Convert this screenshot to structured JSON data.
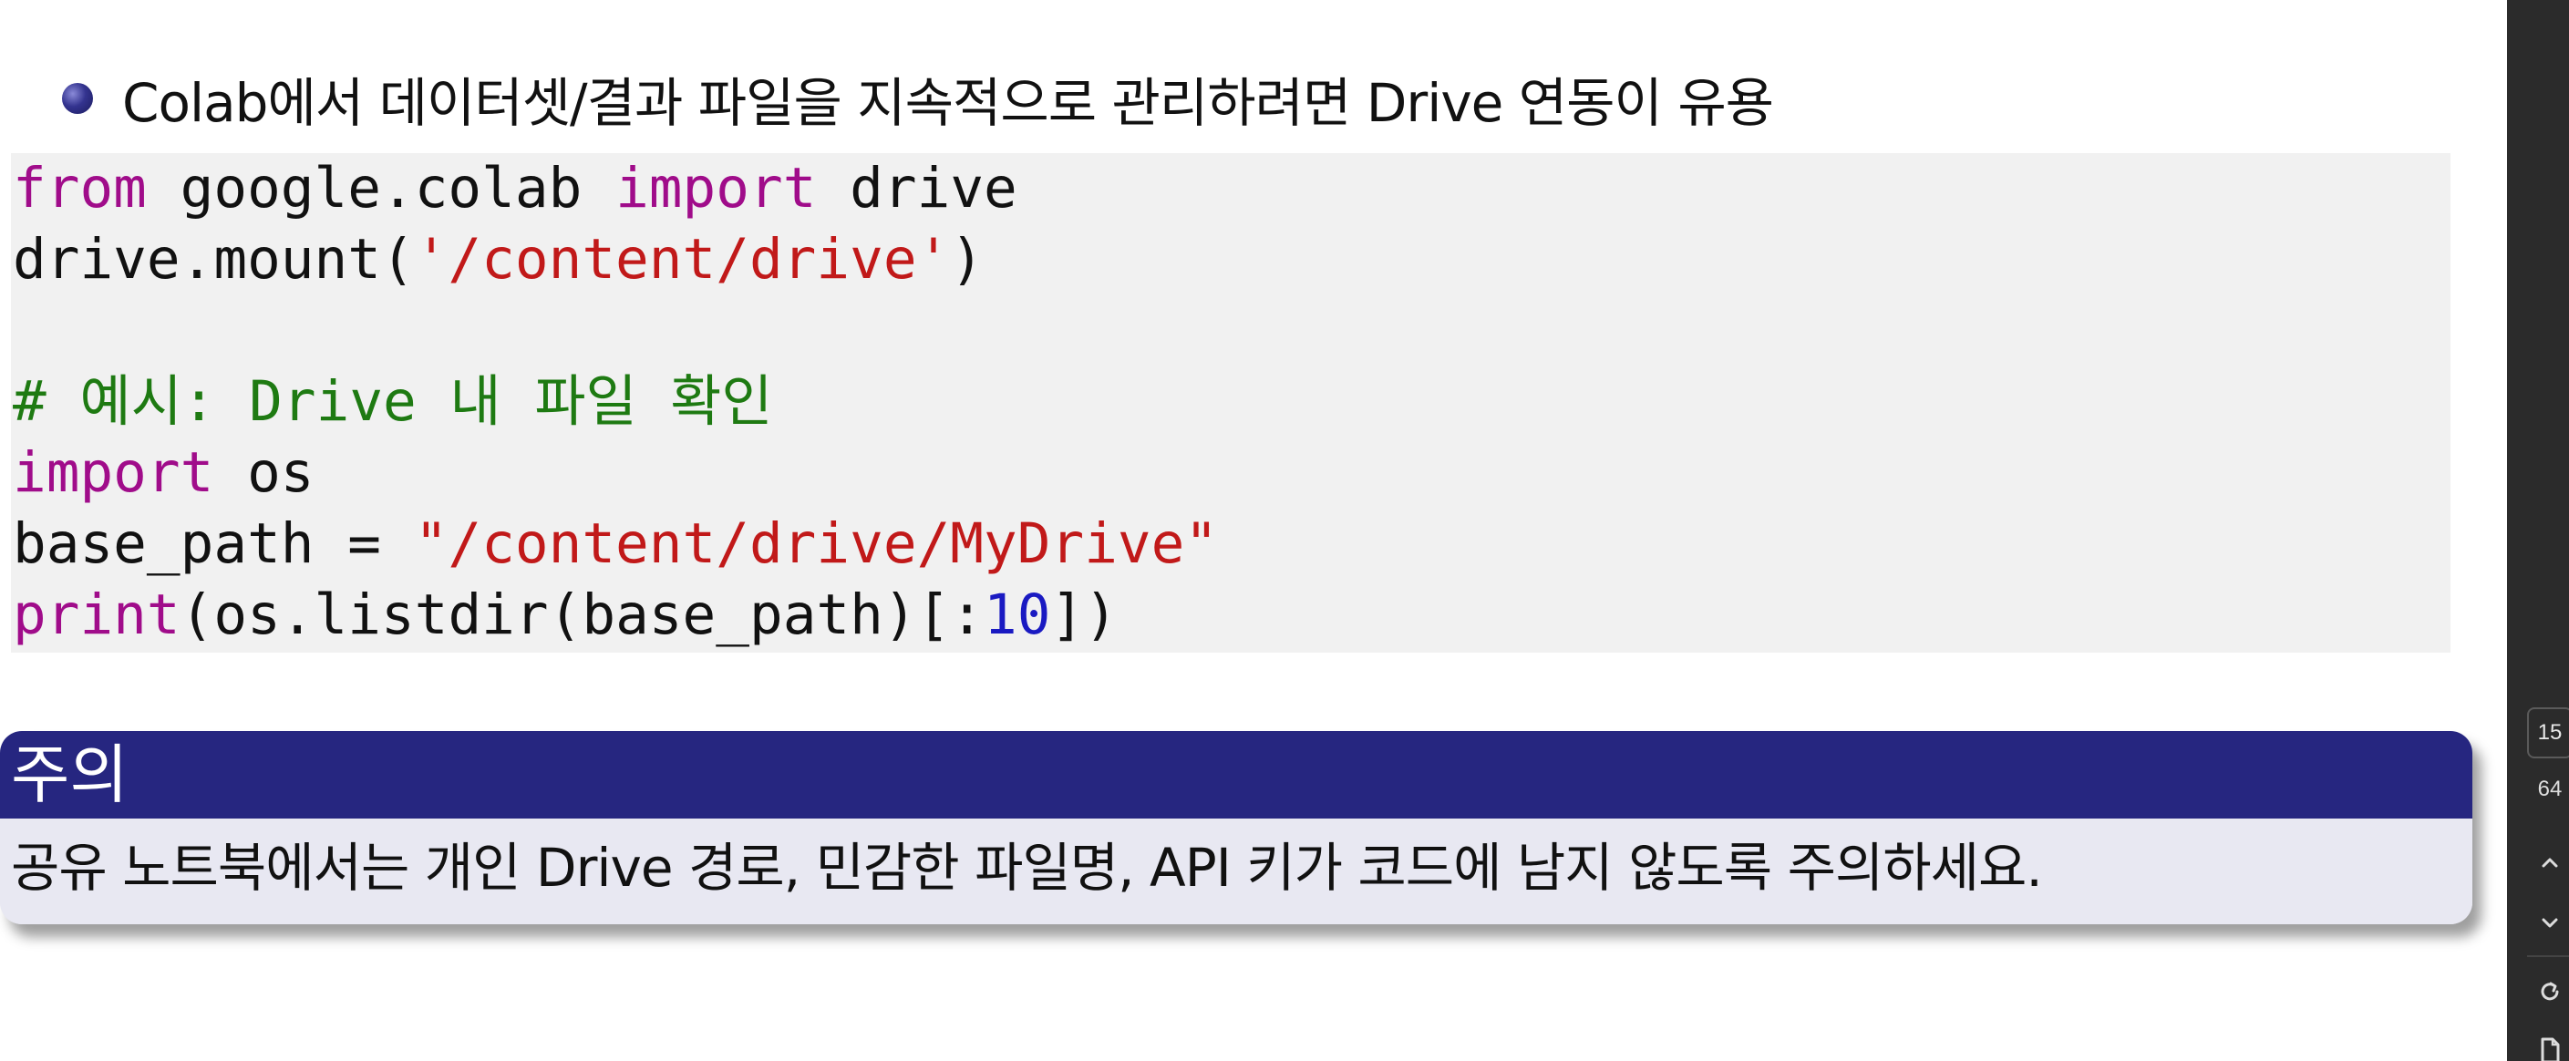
{
  "slide": {
    "bullet_text": "Colab에서 데이터셋/결과 파일을 지속적으로 관리하려면 Drive 연동이 유용",
    "code": {
      "line1": {
        "kw1": "from",
        "t1": " google.colab ",
        "kw2": "import",
        "t2": " drive"
      },
      "line2": {
        "t1": "drive.mount(",
        "s1": "'/content/drive'",
        "t2": ")"
      },
      "line4": {
        "comment": "# 예시: Drive 내 파일 확인"
      },
      "line5": {
        "kw1": "import",
        "t1": " os"
      },
      "line6": {
        "t1": "base_path = ",
        "s1": "\"/content/drive/MyDrive\""
      },
      "line7": {
        "kw1": "print",
        "t1": "(os.listdir(base_path)[:",
        "n1": "10",
        "t2": "])"
      }
    },
    "alert": {
      "title": "주의",
      "body": "공유 노트북에서는 개인 Drive 경로, 민감한 파일명, API 키가 코드에 남지 않도록 주의하세요."
    }
  },
  "viewer": {
    "current_page": "15",
    "total_pages": "64",
    "icons": [
      "chevron-up-icon",
      "chevron-down-icon",
      "refresh-icon",
      "document-icon"
    ]
  },
  "colors": {
    "keyword": "#a00c8a",
    "string": "#c11919",
    "number": "#1a1ac2",
    "comment": "#1e7a12",
    "alert_header": "#262680",
    "alert_body": "#e8e8f2",
    "code_background": "#f1f1f1"
  }
}
